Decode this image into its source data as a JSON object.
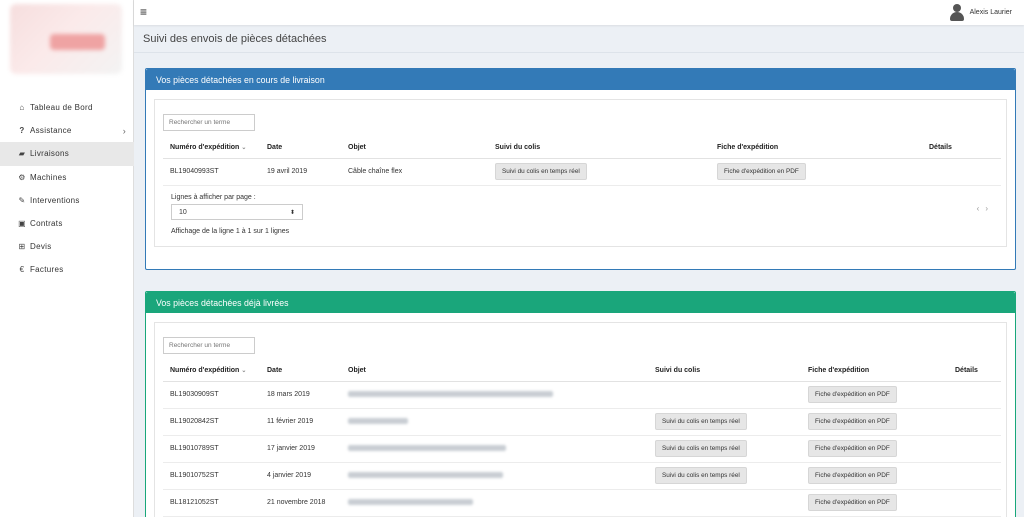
{
  "topbar": {
    "menu_icon": "≡",
    "user_name": "Alexis Laurier"
  },
  "sidebar": {
    "items": [
      {
        "icon": "home-icon",
        "glyph": "⌂",
        "label": "Tableau de Bord"
      },
      {
        "icon": "question-icon",
        "glyph": "?",
        "label": "Assistance",
        "chevron": "›"
      },
      {
        "icon": "truck-icon",
        "glyph": "▰",
        "label": "Livraisons",
        "active": true
      },
      {
        "icon": "gears-icon",
        "glyph": "⚙",
        "label": "Machines"
      },
      {
        "icon": "wrench-icon",
        "glyph": "✎",
        "label": "Interventions"
      },
      {
        "icon": "briefcase-icon",
        "glyph": "▣",
        "label": "Contrats"
      },
      {
        "icon": "cart-icon",
        "glyph": "⊞",
        "label": "Devis"
      },
      {
        "icon": "euro-icon",
        "glyph": "€",
        "label": "Factures"
      }
    ]
  },
  "page": {
    "title": "Suivi des envois de pièces détachées"
  },
  "panel_en_cours": {
    "title": "Vos pièces détachées en cours de livraison",
    "color": "#337ab7",
    "search_placeholder": "Rechercher un terme",
    "columns": [
      "Numéro d'expédition",
      "Date",
      "Objet",
      "Suivi du colis",
      "Fiche d'expédition",
      "Détails"
    ],
    "rows": [
      {
        "numero": "BL19040993ST",
        "date": "19 avril 2019",
        "objet": "Câble chaîne flex",
        "suivi": "Suivi du colis en temps réel",
        "fiche": "Fiche d'expédition en PDF"
      }
    ],
    "lines_label": "Lignes à afficher par page :",
    "lines_value": "10",
    "info": "Affichage de la ligne 1 à 1 sur 1 lignes",
    "pager_prev": "‹",
    "pager_next": "›"
  },
  "panel_livrees": {
    "title": "Vos pièces détachées déjà livrées",
    "color": "#1aa67b",
    "search_placeholder": "Rechercher un terme",
    "columns": [
      "Numéro d'expédition",
      "Date",
      "Objet",
      "Suivi du colis",
      "Fiche d'expédition",
      "Détails"
    ],
    "rows": [
      {
        "numero": "BL19030909ST",
        "date": "18 mars 2019",
        "suivi": "",
        "fiche": "Fiche d'expédition en PDF"
      },
      {
        "numero": "BL19020842ST",
        "date": "11 février 2019",
        "suivi": "Suivi du colis en temps réel",
        "fiche": "Fiche d'expédition en PDF"
      },
      {
        "numero": "BL19010789ST",
        "date": "17 janvier 2019",
        "suivi": "Suivi du colis en temps réel",
        "fiche": "Fiche d'expédition en PDF"
      },
      {
        "numero": "BL19010752ST",
        "date": "4 janvier 2019",
        "suivi": "Suivi du colis en temps réel",
        "fiche": "Fiche d'expédition en PDF"
      },
      {
        "numero": "BL18121052ST",
        "date": "21 novembre 2018",
        "suivi": "",
        "fiche": "Fiche d'expédition en PDF"
      }
    ]
  }
}
